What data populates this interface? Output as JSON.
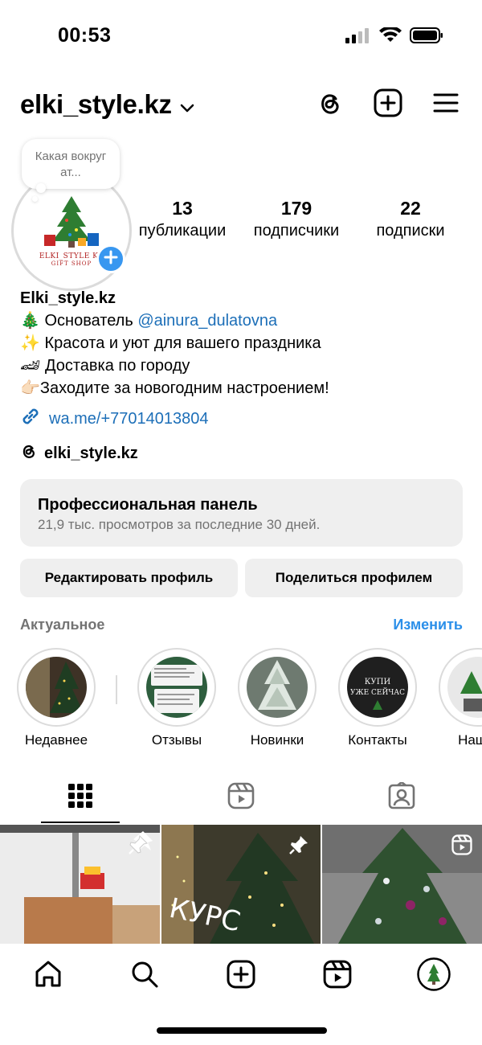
{
  "status_bar": {
    "time": "00:53"
  },
  "header": {
    "username": "elki_style.kz"
  },
  "note": {
    "text": "Какая вокруг ат..."
  },
  "avatar": {
    "brand": "ELKI_STYLE KZ",
    "tagline": "GIFT SHOP"
  },
  "stats": [
    {
      "value": "13",
      "label": "публикации"
    },
    {
      "value": "179",
      "label": "подписчики"
    },
    {
      "value": "22",
      "label": "подписки"
    }
  ],
  "bio": {
    "name": "Elki_style.kz",
    "line1_emoji": "🎄",
    "line1_text": " Основатель ",
    "line1_mention": "@ainura_dulatovna",
    "line2": "✨ Красота и уют для вашего праздника",
    "line3": "🏎 Доставка по городу",
    "line4": "👉🏻Заходите за новогодним настроением!",
    "link": "wa.me/+77014013804",
    "threads": "elki_style.kz"
  },
  "pro_panel": {
    "title": "Профессиональная панель",
    "subtitle": "21,9 тыс. просмотров за последние 30 дней."
  },
  "buttons": {
    "edit": "Редактировать профиль",
    "share": "Поделиться профилем"
  },
  "highlights": {
    "title": "Актуальное",
    "edit": "Изменить",
    "items": [
      {
        "label": "Недавнее"
      },
      {
        "label": "Отзывы"
      },
      {
        "label": "Новинки"
      },
      {
        "label": "Контакты",
        "overlay": "КУПИ\nУЖЕ СЕЙЧАС"
      },
      {
        "label": "Наш б"
      }
    ]
  },
  "grid": {
    "post2_text": "КУРС"
  },
  "colors": {
    "accent": "#3897f0",
    "link": "#1d6fb8",
    "panel": "#efefef"
  }
}
